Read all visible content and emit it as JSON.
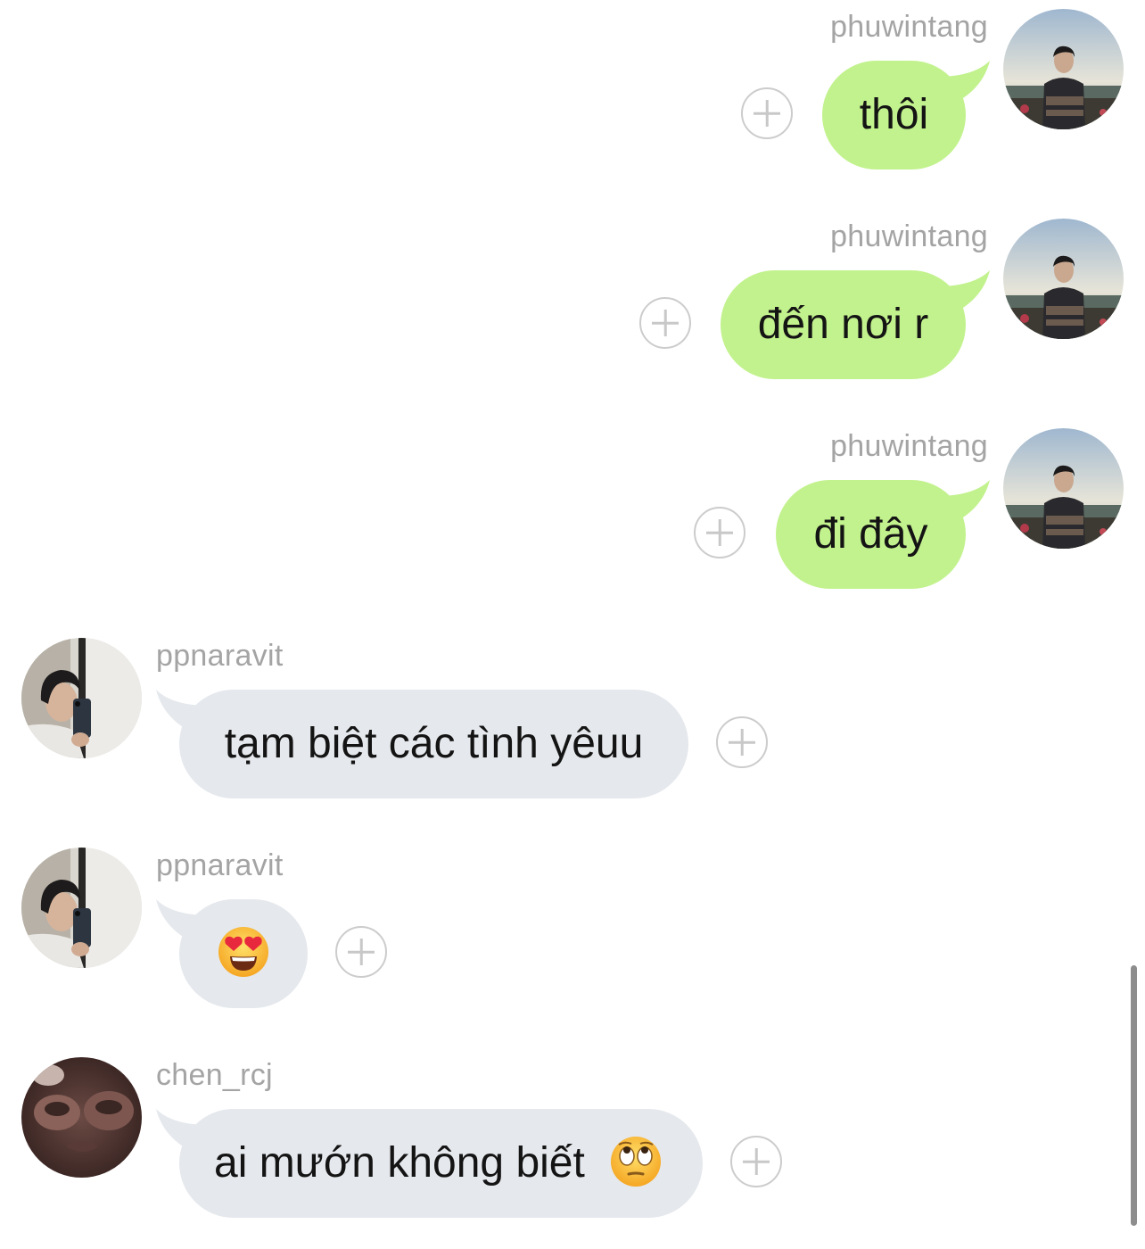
{
  "messages": [
    {
      "id": "m1",
      "direction": "out",
      "username": "phuwintang",
      "text": "thôi",
      "avatar": "avatar-phuwintang"
    },
    {
      "id": "m2",
      "direction": "out",
      "username": "phuwintang",
      "text": "đến nơi r",
      "avatar": "avatar-phuwintang"
    },
    {
      "id": "m3",
      "direction": "out",
      "username": "phuwintang",
      "text": "đi đây",
      "avatar": "avatar-phuwintang"
    },
    {
      "id": "m4",
      "direction": "in",
      "username": "ppnaravit",
      "text": "tạm biệt các tình yêuu",
      "avatar": "avatar-ppnaravit"
    },
    {
      "id": "m5",
      "direction": "in",
      "username": "ppnaravit",
      "text": "",
      "emoji": "heart-eyes-emoji",
      "avatar": "avatar-ppnaravit"
    },
    {
      "id": "m6",
      "direction": "in",
      "username": "chen_rcj",
      "text": "ai mướn không biết",
      "emoji": "eye-roll-emoji",
      "avatar": "avatar-chen_rcj"
    }
  ],
  "colors": {
    "outgoing_bubble": "#c2f28d",
    "incoming_bubble": "#e5e8ec",
    "username": "#a4a4a4",
    "message_text": "#141414"
  },
  "icons": {
    "add_reaction": "plus-circle-icon"
  }
}
